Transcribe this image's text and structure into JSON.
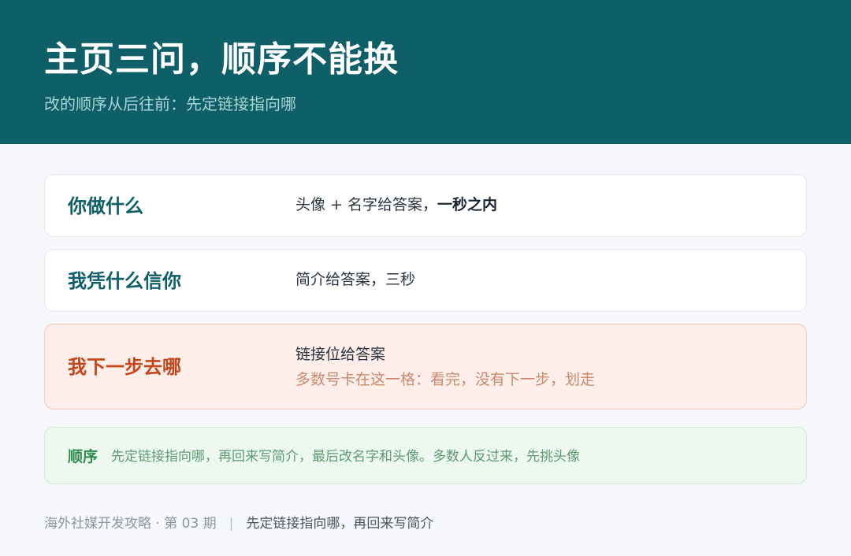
{
  "header": {
    "title": "主页三问，顺序不能换",
    "subtitle": "改的顺序从后往前：先定链接指向哪"
  },
  "questions": [
    {
      "label": "你做什么",
      "answer_prefix": "头像 + 名字给答案，",
      "answer_emphasis": "一秒之内"
    },
    {
      "label": "我凭什么信你",
      "answer": "简介给答案，三秒"
    },
    {
      "label": "我下一步去哪",
      "answer": "链接位给答案",
      "note": "多数号卡在这一格：看完，没有下一步，划走"
    }
  ],
  "order_note": {
    "label": "顺序",
    "text": "先定链接指向哪，再回来写简介，最后改名字和头像。多数人反过来，先挑头像"
  },
  "footer": {
    "series": "海外社媒开发攻略 · 第 03 期",
    "separator": "|",
    "tagline": "先定链接指向哪，再回来写简介"
  },
  "colors": {
    "header_bg": "#0f5f68",
    "accent_teal": "#0f5f68",
    "highlight_orange": "#c4461a",
    "highlight_bg": "#fdeee9",
    "note_green": "#2f8a4f",
    "note_bg": "#ecf8f0"
  }
}
